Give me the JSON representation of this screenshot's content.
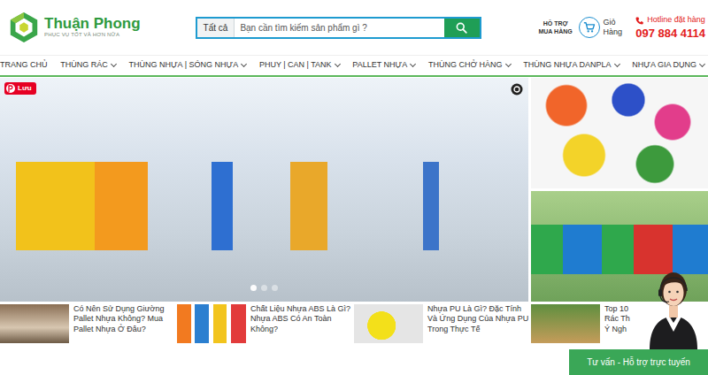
{
  "logo": {
    "name": "Thuận Phong",
    "tagline": "PHỤC VỤ TỐT VÀ HƠN NỮA"
  },
  "search": {
    "category": "Tất cả",
    "placeholder": "Bạn cần tìm kiếm sản phẩm gì ?"
  },
  "support": {
    "label": "HỖ TRỢ MUA HÀNG"
  },
  "cart": {
    "label": "Giỏ Hàng"
  },
  "hotline": {
    "label": "Hotline đặt hàng",
    "number": "097 884 4114"
  },
  "nav": [
    {
      "label": "TRANG CHỦ",
      "dropdown": false
    },
    {
      "label": "THÙNG RÁC",
      "dropdown": true
    },
    {
      "label": "THÙNG NHỰA | SÓNG NHỰA",
      "dropdown": true
    },
    {
      "label": "PHUY | CAN | TANK",
      "dropdown": true
    },
    {
      "label": "PALLET NHỰA",
      "dropdown": true
    },
    {
      "label": "THÙNG CHỞ HÀNG",
      "dropdown": true
    },
    {
      "label": "THÙNG NHỰA DANPLA",
      "dropdown": true
    },
    {
      "label": "NHỰA GIA DỤNG",
      "dropdown": true
    }
  ],
  "hero": {
    "save_badge": "Lưu",
    "slides": [
      {
        "selected": true
      },
      {
        "selected": false
      },
      {
        "selected": false
      }
    ]
  },
  "articles": [
    {
      "title": "Có Nên Sử Dụng Giường Pallet Nhựa Không? Mua Pallet Nhựa Ở Đâu?"
    },
    {
      "title": "Chất Liệu Nhựa ABS Là Gì? Nhựa ABS Có An Toàn Không?"
    },
    {
      "title": "Nhựa PU Là Gì? Đặc Tính Và Ứng Dụng Của Nhựa PU Trong Thực Tế"
    },
    {
      "title": "Top 10\nRác Th\nÝ Ngh"
    }
  ],
  "chat": {
    "label": "Tư vấn - Hỗ trợ trực tuyến"
  }
}
